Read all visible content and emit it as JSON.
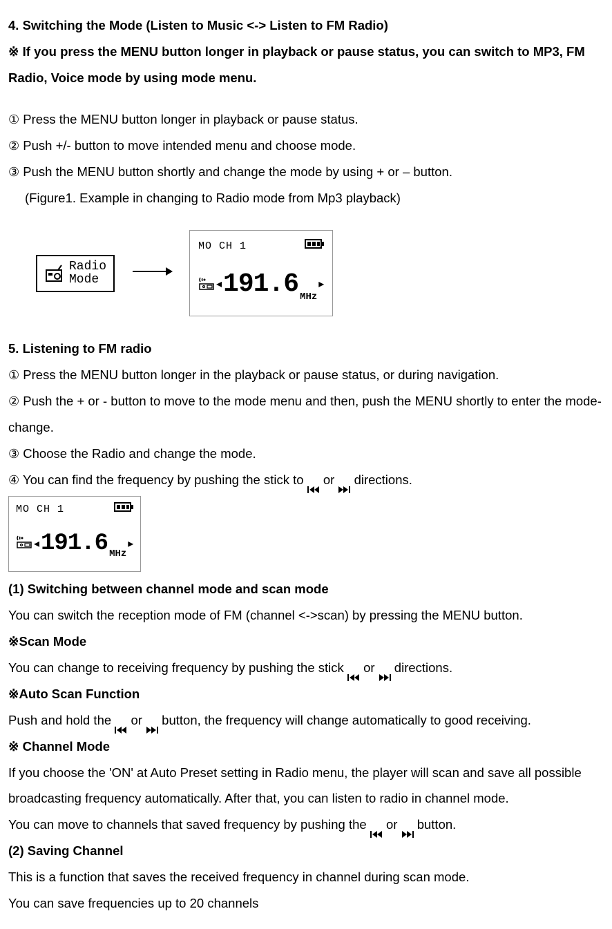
{
  "s4": {
    "heading": "4. Switching the Mode (Listen to Music <-> Listen to FM Radio)",
    "note_sym": "※",
    "note_text": " If you press the MENU button longer in playback or pause status, you can switch to MP3, FM Radio, Voice mode by using mode menu.",
    "steps": {
      "n1": "①",
      "n2": "②",
      "n3": "③",
      "t1": "Press the MENU button longer in playback or pause status.",
      "t2": "Push +/- button to move intended menu and choose mode.",
      "t3": "Push the MENU button shortly and change the mode by using + or – button."
    },
    "fig_caption": "(Figure1. Example in changing to Radio mode from Mp3 playback)"
  },
  "radio_mode_box": {
    "line1": "Radio",
    "line2": "Mode"
  },
  "lcd": {
    "top": "MO  CH 1",
    "tri_l": "◂",
    "freq": "191.6",
    "unit": "MHz",
    "tri_r": "▸"
  },
  "s5": {
    "heading": "5. Listening to FM radio",
    "steps": {
      "n1": "①",
      "n2": "②",
      "n3": "③",
      "n4": "④",
      "t1": "Press the MENU button longer in the playback or pause status, or during navigation.",
      "t2": "Push the + or - button to move to the mode menu and then, push the MENU shortly to enter the mode-change.",
      "t3": " Choose the Radio and change the mode.",
      "t4a": " You can find the frequency by pushing the stick to ",
      "t4b": " or ",
      "t4c": " directions."
    }
  },
  "sub1": {
    "heading": "(1) Switching between channel mode and scan mode",
    "text": "You can switch the reception mode of FM (channel <->scan) by pressing the MENU button."
  },
  "scan": {
    "sym": "※",
    "title": "Scan Mode",
    "text_a": "You can change to receiving frequency by pushing the stick ",
    "text_b": " or ",
    "text_c": " directions."
  },
  "auto": {
    "sym": "※",
    "title": "Auto Scan Function",
    "text_a": "Push and hold the ",
    "text_b": " or ",
    "text_c": " button, the frequency will change automatically to good receiving."
  },
  "channel": {
    "sym": "※",
    "title": " Channel Mode",
    "p1": "If you choose the 'ON' at Auto Preset setting in Radio menu, the player will scan and save all possible broadcasting frequency automatically. After that, you can listen to radio in channel mode.",
    "p2a": "You can move to channels that saved frequency by pushing the ",
    "p2b": " or ",
    "p2c": " button."
  },
  "sub2": {
    "heading": "(2) Saving Channel",
    "p1": "This is a function that saves the received frequency in channel during scan mode.",
    "p2": "You can save frequencies up to 20 channels"
  }
}
